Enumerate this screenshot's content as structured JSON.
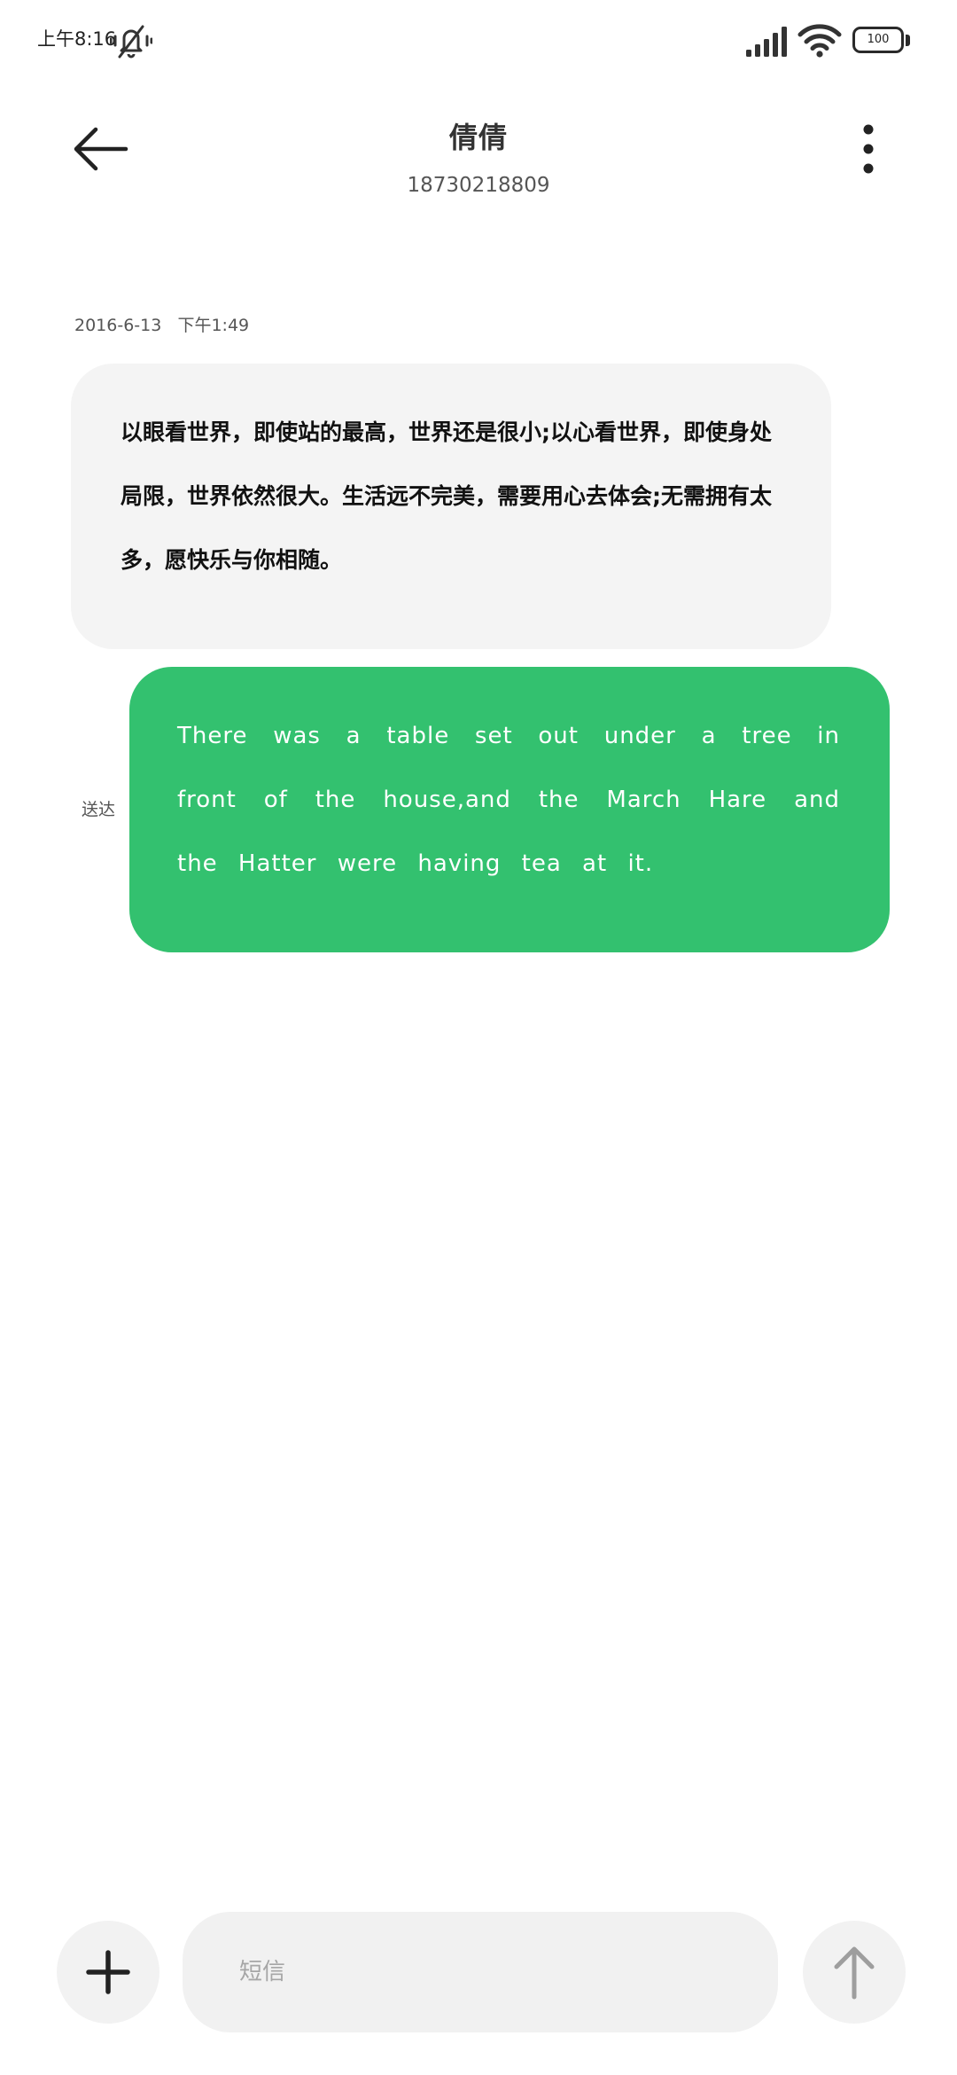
{
  "status_bar": {
    "time": "上午8:16",
    "battery": "100",
    "icons": [
      "mute-icon",
      "signal-icon",
      "wifi-icon",
      "battery-icon"
    ]
  },
  "header": {
    "contact_name": "倩倩",
    "phone_number": "18730218809",
    "back_icon": "arrow-left-icon",
    "menu_icon": "more-vertical-icon"
  },
  "conversation": {
    "timestamp": "2016-6-13   下午1:49",
    "messages": [
      {
        "direction": "incoming",
        "text": "以眼看世界，即使站的最高，世界还是很小;以心看世界，即使身处局限，世界依然很大。生活远不完美，需要用心去体会;无需拥有太多，愿快乐与你相随。"
      },
      {
        "direction": "outgoing",
        "text": "There was a table set out under a tree in front of the house,and the March Hare and the Hatter were having tea at it.",
        "status": "送达"
      }
    ]
  },
  "composer": {
    "placeholder": "短信",
    "add_icon": "plus-icon",
    "send_icon": "arrow-up-icon"
  },
  "colors": {
    "outgoing_bubble": "#33c16f",
    "incoming_bubble": "#f4f4f4",
    "background": "#ffffff"
  }
}
